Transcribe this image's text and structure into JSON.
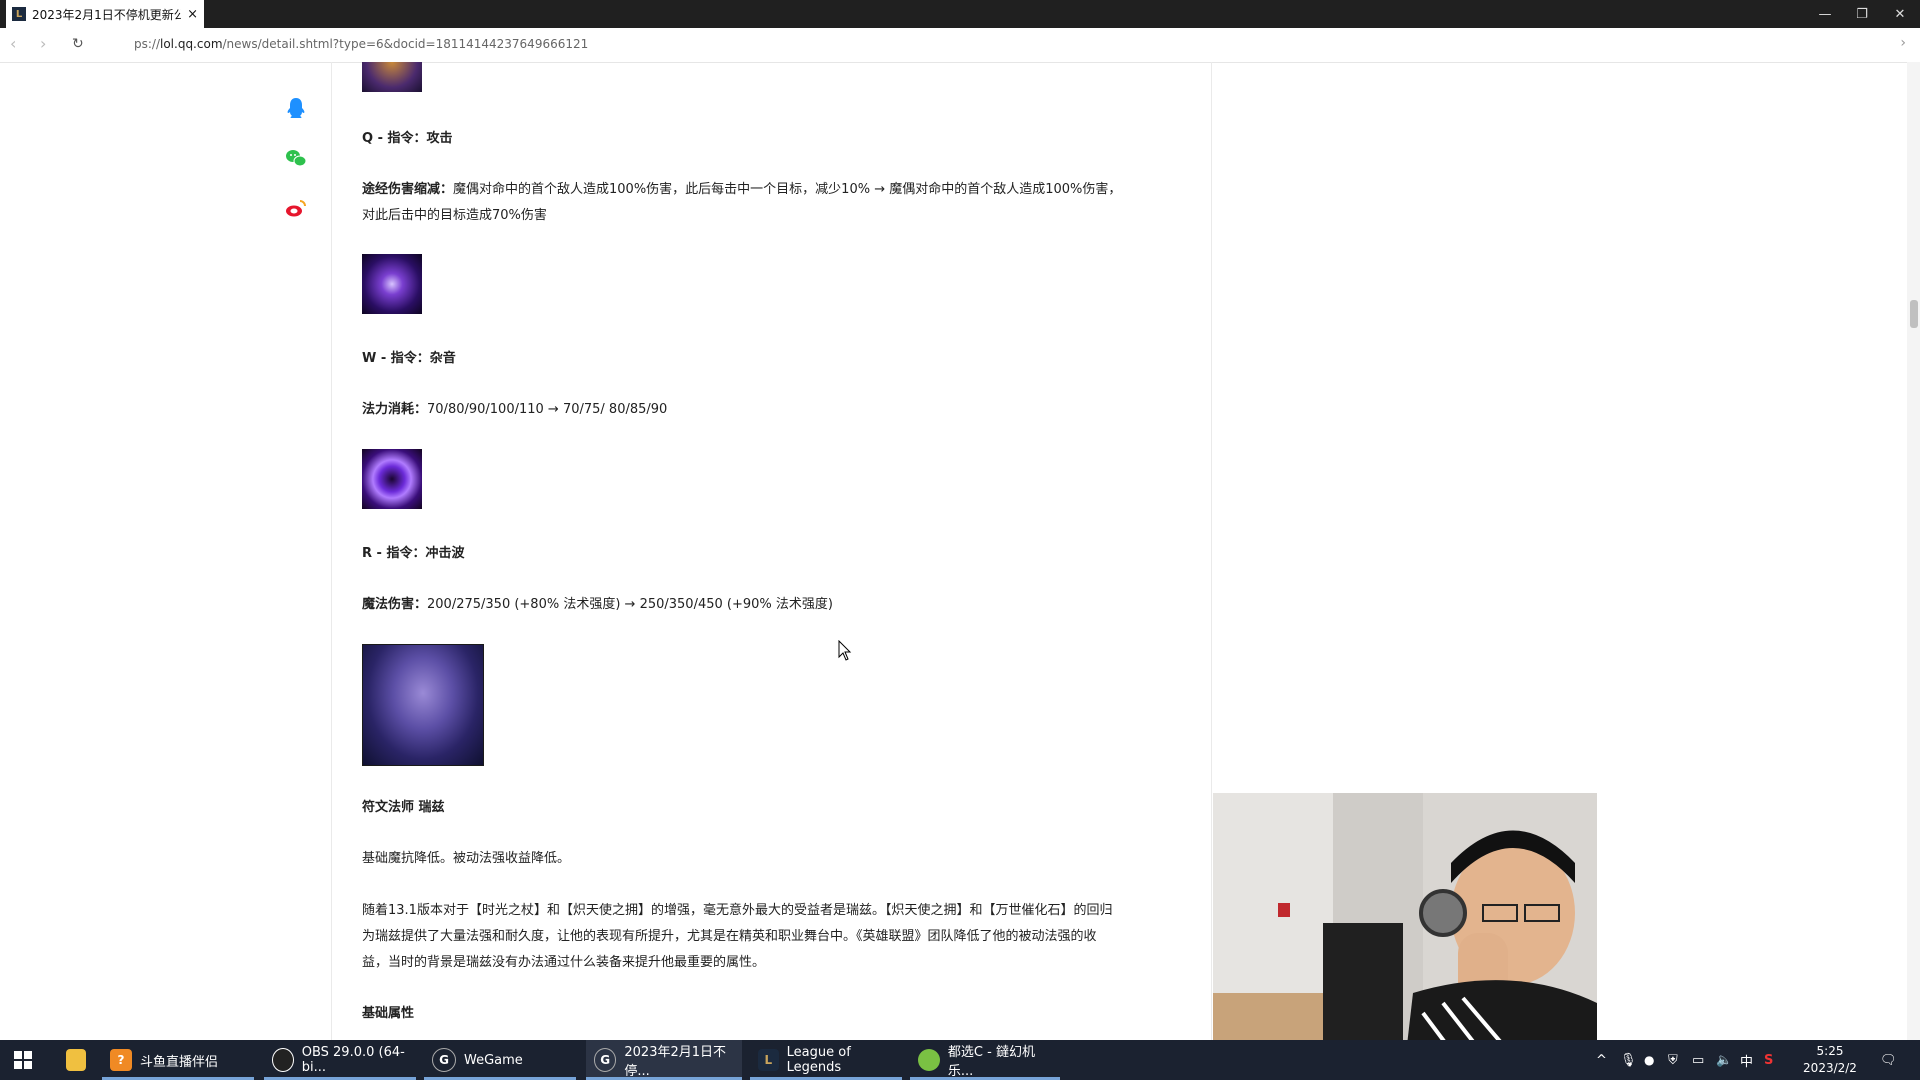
{
  "browser": {
    "tab_title": "2023年2月1日不停机更新公",
    "tab_close": "×",
    "url_prefix": "ps://",
    "url_host": "lol.qq.com",
    "url_path": "/news/detail.shtml?type=6&docid=18114144237649666121",
    "minimize": "—",
    "restore": "❐",
    "close": "✕"
  },
  "article": {
    "q_title": "Q - 指令：攻击",
    "q_label": "途经伤害缩减：",
    "q_text_1": "魔偶对命中的首个敌人造成100%伤害，此后每击中一个目标，减少10% → 魔偶对命中的首个敌人造成100%伤害，",
    "q_text_2": "对此后击中的目标造成70%伤害",
    "w_title": "W - 指令：杂音",
    "w_label": "法力消耗：",
    "w_text": "70/80/90/100/110 → 70/75/ 80/85/90",
    "r_title": "R - 指令：冲击波",
    "r_label": "魔法伤害：",
    "r_text": "200/275/350 (+80% 法术强度) → 250/350/450 (+90% 法术强度)",
    "ryze_title": "符文法师 瑞兹",
    "ryze_summary": "基础魔抗降低。被动法强收益降低。",
    "ryze_para_1": "随着13.1版本对于【时光之杖】和【炽天使之拥】的增强，毫无意外最大的受益者是瑞兹。【炽天使之拥】和【万世催化石】的回归",
    "ryze_para_2": "为瑞兹提供了大量法强和耐久度，让他的表现有所提升，尤其是在精英和职业舞台中。《英雄联盟》团队降低了他的被动法强的收",
    "ryze_para_3": "益，当时的背景是瑞兹没有办法通过什么装备来提升他最重要的属性。",
    "base_stats": "基础属性"
  },
  "taskbar": {
    "items": [
      {
        "label": "斗鱼直播伴侣"
      },
      {
        "label": "OBS 29.0.0 (64-bi..."
      },
      {
        "label": "WeGame"
      },
      {
        "label": "2023年2月1日不停..."
      },
      {
        "label": "League of Legends"
      },
      {
        "label": "都选C - 鐽幻机乐..."
      }
    ],
    "ime": "中",
    "time": "5:25",
    "date": "2023/2/2"
  },
  "colors": {
    "taskbar_bg": "#1b2230",
    "accent": "#77a4d8",
    "title_bg": "#202020"
  }
}
